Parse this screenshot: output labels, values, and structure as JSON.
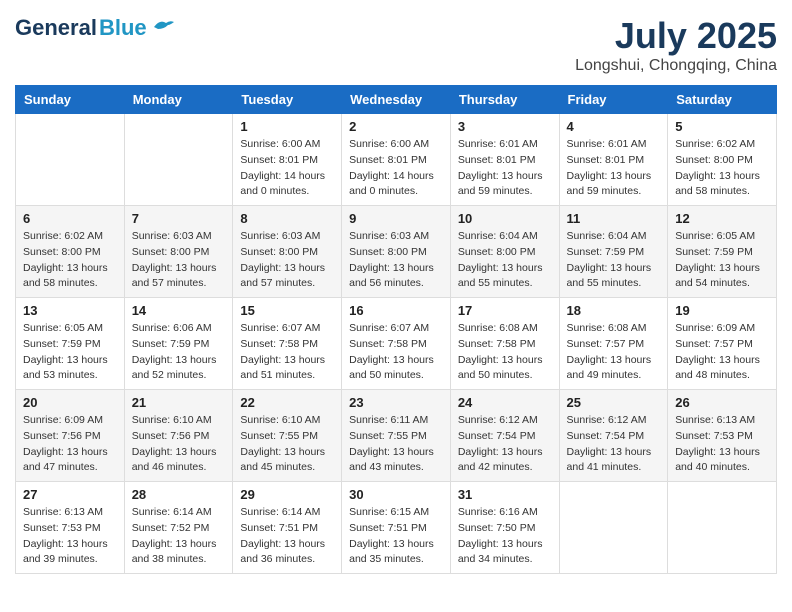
{
  "header": {
    "logo_general": "General",
    "logo_blue": "Blue",
    "month_title": "July 2025",
    "location": "Longshui, Chongqing, China"
  },
  "days_of_week": [
    "Sunday",
    "Monday",
    "Tuesday",
    "Wednesday",
    "Thursday",
    "Friday",
    "Saturday"
  ],
  "weeks": [
    [
      {
        "day": "",
        "info": ""
      },
      {
        "day": "",
        "info": ""
      },
      {
        "day": "1",
        "info": "Sunrise: 6:00 AM\nSunset: 8:01 PM\nDaylight: 14 hours\nand 0 minutes."
      },
      {
        "day": "2",
        "info": "Sunrise: 6:00 AM\nSunset: 8:01 PM\nDaylight: 14 hours\nand 0 minutes."
      },
      {
        "day": "3",
        "info": "Sunrise: 6:01 AM\nSunset: 8:01 PM\nDaylight: 13 hours\nand 59 minutes."
      },
      {
        "day": "4",
        "info": "Sunrise: 6:01 AM\nSunset: 8:01 PM\nDaylight: 13 hours\nand 59 minutes."
      },
      {
        "day": "5",
        "info": "Sunrise: 6:02 AM\nSunset: 8:00 PM\nDaylight: 13 hours\nand 58 minutes."
      }
    ],
    [
      {
        "day": "6",
        "info": "Sunrise: 6:02 AM\nSunset: 8:00 PM\nDaylight: 13 hours\nand 58 minutes."
      },
      {
        "day": "7",
        "info": "Sunrise: 6:03 AM\nSunset: 8:00 PM\nDaylight: 13 hours\nand 57 minutes."
      },
      {
        "day": "8",
        "info": "Sunrise: 6:03 AM\nSunset: 8:00 PM\nDaylight: 13 hours\nand 57 minutes."
      },
      {
        "day": "9",
        "info": "Sunrise: 6:03 AM\nSunset: 8:00 PM\nDaylight: 13 hours\nand 56 minutes."
      },
      {
        "day": "10",
        "info": "Sunrise: 6:04 AM\nSunset: 8:00 PM\nDaylight: 13 hours\nand 55 minutes."
      },
      {
        "day": "11",
        "info": "Sunrise: 6:04 AM\nSunset: 7:59 PM\nDaylight: 13 hours\nand 55 minutes."
      },
      {
        "day": "12",
        "info": "Sunrise: 6:05 AM\nSunset: 7:59 PM\nDaylight: 13 hours\nand 54 minutes."
      }
    ],
    [
      {
        "day": "13",
        "info": "Sunrise: 6:05 AM\nSunset: 7:59 PM\nDaylight: 13 hours\nand 53 minutes."
      },
      {
        "day": "14",
        "info": "Sunrise: 6:06 AM\nSunset: 7:59 PM\nDaylight: 13 hours\nand 52 minutes."
      },
      {
        "day": "15",
        "info": "Sunrise: 6:07 AM\nSunset: 7:58 PM\nDaylight: 13 hours\nand 51 minutes."
      },
      {
        "day": "16",
        "info": "Sunrise: 6:07 AM\nSunset: 7:58 PM\nDaylight: 13 hours\nand 50 minutes."
      },
      {
        "day": "17",
        "info": "Sunrise: 6:08 AM\nSunset: 7:58 PM\nDaylight: 13 hours\nand 50 minutes."
      },
      {
        "day": "18",
        "info": "Sunrise: 6:08 AM\nSunset: 7:57 PM\nDaylight: 13 hours\nand 49 minutes."
      },
      {
        "day": "19",
        "info": "Sunrise: 6:09 AM\nSunset: 7:57 PM\nDaylight: 13 hours\nand 48 minutes."
      }
    ],
    [
      {
        "day": "20",
        "info": "Sunrise: 6:09 AM\nSunset: 7:56 PM\nDaylight: 13 hours\nand 47 minutes."
      },
      {
        "day": "21",
        "info": "Sunrise: 6:10 AM\nSunset: 7:56 PM\nDaylight: 13 hours\nand 46 minutes."
      },
      {
        "day": "22",
        "info": "Sunrise: 6:10 AM\nSunset: 7:55 PM\nDaylight: 13 hours\nand 45 minutes."
      },
      {
        "day": "23",
        "info": "Sunrise: 6:11 AM\nSunset: 7:55 PM\nDaylight: 13 hours\nand 43 minutes."
      },
      {
        "day": "24",
        "info": "Sunrise: 6:12 AM\nSunset: 7:54 PM\nDaylight: 13 hours\nand 42 minutes."
      },
      {
        "day": "25",
        "info": "Sunrise: 6:12 AM\nSunset: 7:54 PM\nDaylight: 13 hours\nand 41 minutes."
      },
      {
        "day": "26",
        "info": "Sunrise: 6:13 AM\nSunset: 7:53 PM\nDaylight: 13 hours\nand 40 minutes."
      }
    ],
    [
      {
        "day": "27",
        "info": "Sunrise: 6:13 AM\nSunset: 7:53 PM\nDaylight: 13 hours\nand 39 minutes."
      },
      {
        "day": "28",
        "info": "Sunrise: 6:14 AM\nSunset: 7:52 PM\nDaylight: 13 hours\nand 38 minutes."
      },
      {
        "day": "29",
        "info": "Sunrise: 6:14 AM\nSunset: 7:51 PM\nDaylight: 13 hours\nand 36 minutes."
      },
      {
        "day": "30",
        "info": "Sunrise: 6:15 AM\nSunset: 7:51 PM\nDaylight: 13 hours\nand 35 minutes."
      },
      {
        "day": "31",
        "info": "Sunrise: 6:16 AM\nSunset: 7:50 PM\nDaylight: 13 hours\nand 34 minutes."
      },
      {
        "day": "",
        "info": ""
      },
      {
        "day": "",
        "info": ""
      }
    ]
  ]
}
